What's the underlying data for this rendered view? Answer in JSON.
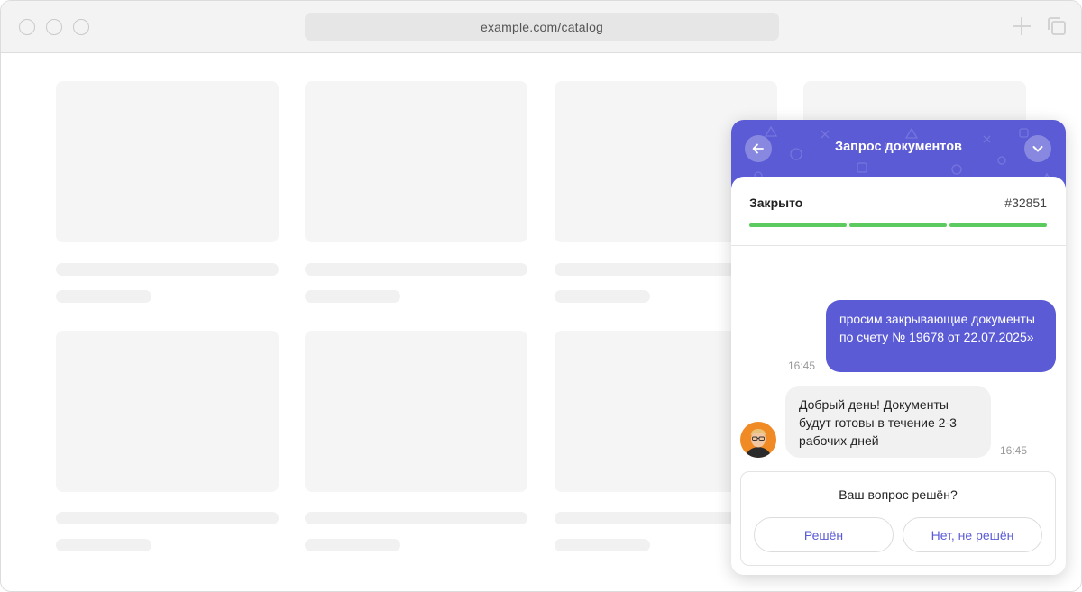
{
  "browser": {
    "url": "example.com/catalog",
    "new_tab_icon": "plus-icon",
    "tabs_icon": "copy-icon"
  },
  "widget": {
    "title": "Запрос документов",
    "back_icon": "arrow-left-icon",
    "collapse_icon": "chevron-down-icon",
    "status": "Закрыто",
    "ticket_number": "#32851",
    "progress_segments": 3,
    "progress_completed": 3,
    "accent_color": "#5b5bd6",
    "success_color": "#5ccb5f",
    "messages": [
      {
        "from": "user",
        "text": "просим закрывающие документы по счету № 19678 от 22.07.2025»",
        "time": "16:45"
      },
      {
        "from": "agent",
        "text": "Добрый день! Документы будут готовы в течение 2-3 рабочих дней",
        "time": "16:45"
      }
    ],
    "resolve": {
      "question": "Ваш вопрос решён?",
      "yes_label": "Решён",
      "no_label": "Нет, не решён"
    }
  }
}
